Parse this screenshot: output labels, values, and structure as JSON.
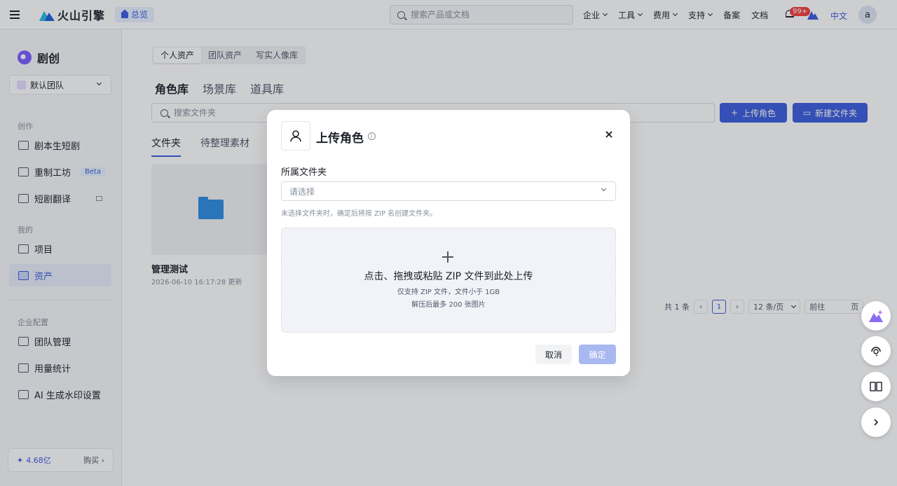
{
  "topbar": {
    "brand": "火山引擎",
    "overview": "总览",
    "search_placeholder": "搜索产品或文档",
    "nav": [
      {
        "label": "企业",
        "has_caret": true
      },
      {
        "label": "工具",
        "has_caret": true
      },
      {
        "label": "费用",
        "has_caret": true
      },
      {
        "label": "支持",
        "has_caret": true
      },
      {
        "label": "备案",
        "has_caret": false
      },
      {
        "label": "文档",
        "has_caret": false
      }
    ],
    "notification_badge": "99+",
    "language": "中文",
    "avatar_letter": "a"
  },
  "sidebar": {
    "app_name": "剧创",
    "team": "默认团队",
    "section_create": "创作",
    "create_items": [
      {
        "label": "剧本生短剧",
        "icon": "script-icon"
      },
      {
        "label": "重制工坊",
        "icon": "remake-icon",
        "badge": "Beta"
      },
      {
        "label": "短剧翻译",
        "icon": "translate-icon"
      }
    ],
    "section_mine": "我的",
    "mine_items": [
      {
        "label": "项目",
        "icon": "cube-icon"
      },
      {
        "label": "资产",
        "icon": "asset-icon",
        "active": true
      }
    ],
    "section_org": "企业配置",
    "org_items": [
      {
        "label": "团队管理",
        "icon": "team-icon"
      },
      {
        "label": "用量统计",
        "icon": "usage-icon"
      },
      {
        "label": "AI 生成水印设置",
        "icon": "watermark-icon"
      }
    ],
    "credits": {
      "star": "✦",
      "amount": "4.68亿",
      "buy": "购买 ›"
    }
  },
  "main": {
    "segments": [
      "个人资产",
      "团队资产",
      "写实人像库"
    ],
    "lib_tabs": [
      "角色库",
      "场景库",
      "道具库"
    ],
    "search_placeholder": "搜索文件夹",
    "upload_role": "上传角色",
    "new_folder": "新建文件夹",
    "sub_tabs": [
      "文件夹",
      "待整理素材"
    ],
    "folder": {
      "name": "管理测试",
      "date": "2026-06-10 16:17:28 更新"
    },
    "pager": {
      "total": "共 1 条",
      "page": "1",
      "size": "12 条/页",
      "jump": "前往",
      "jump_suffix": "页"
    }
  },
  "modal": {
    "title": "上传角色",
    "info": "i",
    "close": "×",
    "folder_label": "所属文件夹",
    "folder_placeholder": "请选择",
    "hint": "未选择文件夹时，确定后将按 ZIP 名创建文件夹。",
    "drop_main": "点击、拖拽或粘贴 ZIP 文件到此处上传",
    "drop_sub1": "仅支持 ZIP 文件，文件小于 1GB",
    "drop_sub2": "解压后最多 200 张图片",
    "cancel": "取消",
    "ok": "确定"
  },
  "colors": {
    "accent": "#3b5ddd",
    "ok_disabled": "#a9b8f0"
  }
}
